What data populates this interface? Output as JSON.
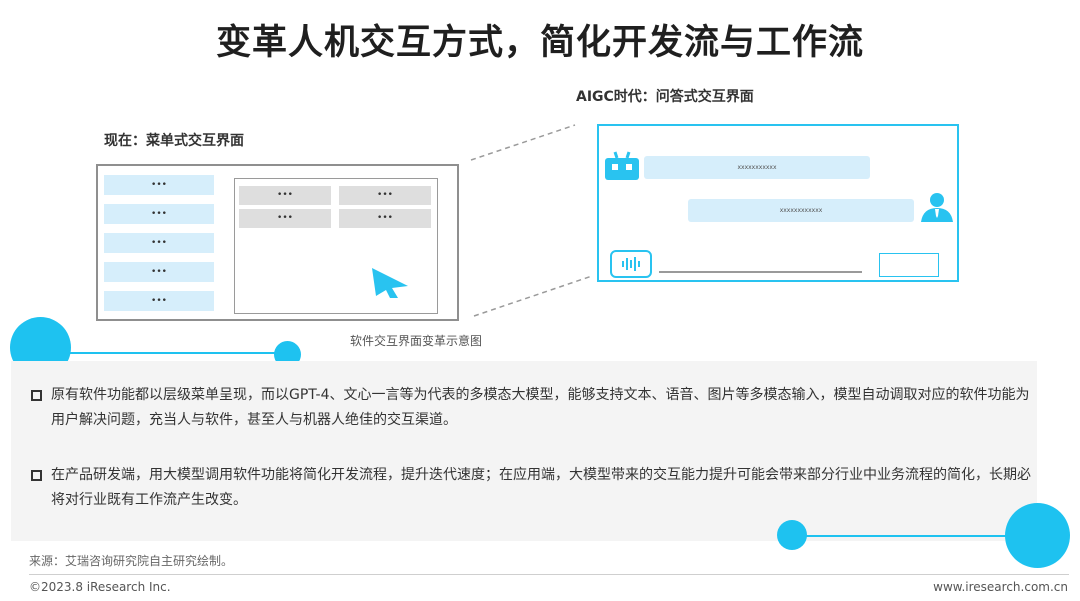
{
  "title": "变革人机交互方式，简化开发流与工作流",
  "menu_ui": {
    "label": "现在：菜单式交互界面",
    "menu_items": [
      "•••",
      "•••",
      "•••",
      "•••",
      "•••"
    ],
    "grid_cells": [
      "•••",
      "•••",
      "•••",
      "•••"
    ]
  },
  "chat_ui": {
    "label": "AIGC时代：问答式交互界面",
    "bot_message": "xxxxxxxxxxx",
    "user_message": "xxxxxxxxxxxx"
  },
  "caption": "软件交互界面变革示意图",
  "bullets": [
    "原有软件功能都以层级菜单呈现，而以GPT-4、文心一言等为代表的多模态大模型，能够支持文本、语音、图片等多模态输入，模型自动调取对应的软件功能为用户解决问题，充当人与软件，甚至人与机器人绝佳的交互渠道。",
    "在产品研发端，用大模型调用软件功能将简化开发流程，提升迭代速度；在应用端，大模型带来的交互能力提升可能会带来部分行业中业务流程的简化，长期必将对行业既有工作流产生改变。"
  ],
  "footer": {
    "source": "来源：艾瑞咨询研究院自主研究绘制。",
    "copyright": "©2023.8 iResearch Inc.",
    "site": "www.iresearch.com.cn"
  },
  "colors": {
    "accent": "#1ec2f0",
    "light_blue": "#d6eefb",
    "text": "#333333"
  }
}
